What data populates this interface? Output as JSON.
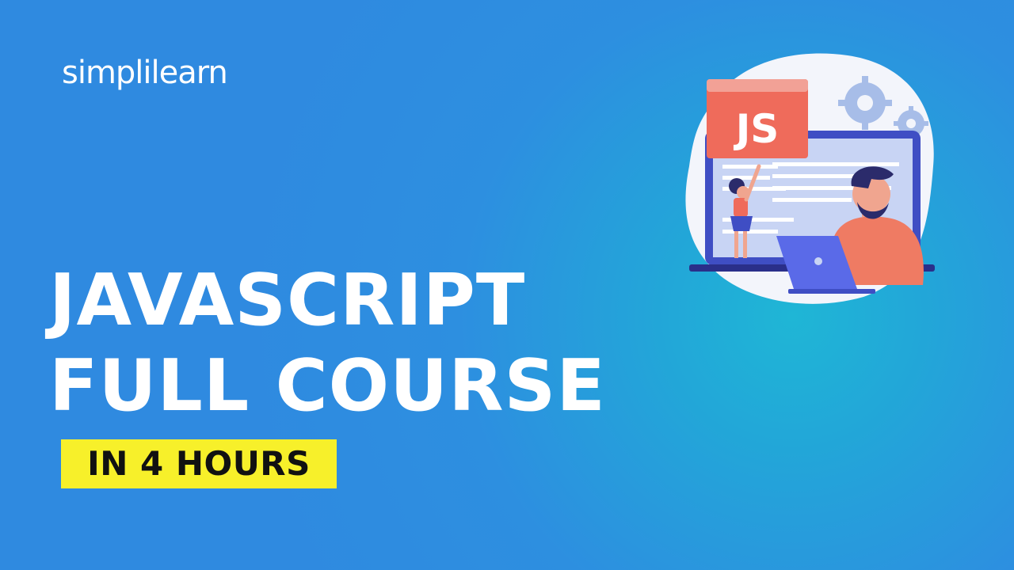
{
  "brand": {
    "logo_text": "simplilearn"
  },
  "headline": {
    "line1": "JAVASCRIPT",
    "line2": "FULL COURSE"
  },
  "badge": {
    "text": "IN 4 HOURS"
  },
  "illustration": {
    "js_card_text": "JS",
    "icons": [
      "gear-icon",
      "laptop-icon",
      "person-icon"
    ]
  },
  "colors": {
    "background": "#2f8ae0",
    "badge_bg": "#f7f02a",
    "js_card": "#ef6b5b",
    "text": "#ffffff"
  }
}
